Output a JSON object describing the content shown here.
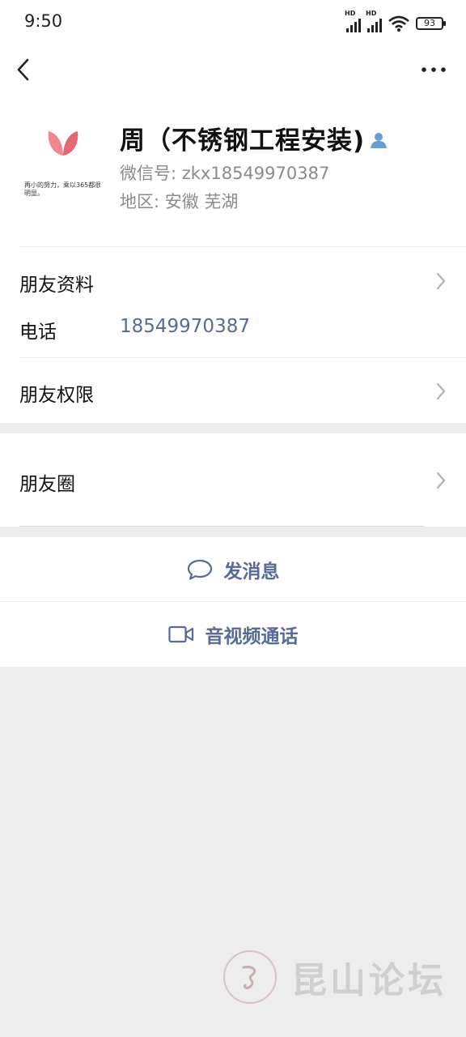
{
  "status_bar": {
    "time": "9:50",
    "signal_1_label": "HD",
    "signal_2_label": "HD",
    "battery": "93"
  },
  "profile": {
    "name": "周（不锈钢工程安装)",
    "wechat_id": "微信号: zkx18549970387",
    "region": "地区: 安徽  芜湖",
    "avatar_caption": "再小的努力，乘以365都很明显。"
  },
  "cells": {
    "friend_info": "朋友资料",
    "phone_label": "电话",
    "phone_value": "18549970387",
    "permissions": "朋友权限",
    "moments": "朋友圈"
  },
  "actions": {
    "message": "发消息",
    "video_call": "音视频通话"
  },
  "watermark": {
    "text": "昆山论坛"
  },
  "colors": {
    "link_blue": "#576b95",
    "page_bg": "#ededed"
  },
  "icons": {
    "back": "chevron-left-icon",
    "more": "more-dots-icon",
    "message": "chat-bubble-icon",
    "video": "video-camera-icon"
  }
}
